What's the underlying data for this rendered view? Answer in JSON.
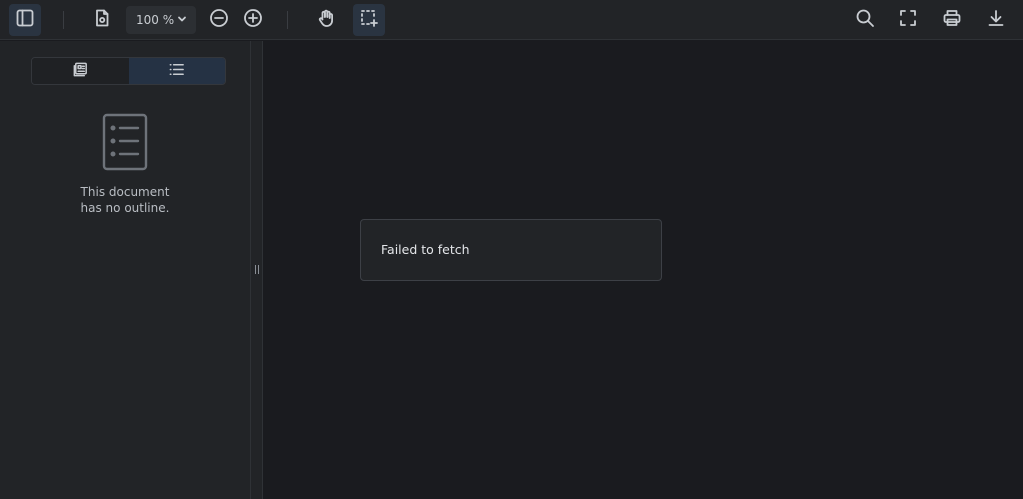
{
  "toolbar": {
    "zoom_value": "100 %",
    "icons": {
      "sidebar_toggle": "sidebar-toggle-icon",
      "document_properties": "document-settings-icon",
      "zoom_dropdown": "chevron-down-icon",
      "zoom_out": "zoom-out-icon",
      "zoom_in": "zoom-in-icon",
      "pan_tool": "hand-icon",
      "selection_tool": "selection-icon",
      "search": "search-icon",
      "fullscreen": "fullscreen-icon",
      "print": "print-icon",
      "download": "download-icon"
    }
  },
  "sidebar": {
    "tabs": [
      {
        "icon": "thumbnails-icon",
        "active": false
      },
      {
        "icon": "outline-list-icon",
        "active": true
      }
    ],
    "empty_icon": "outline-document-icon",
    "empty_line1": "This document",
    "empty_line2": "has no outline."
  },
  "main": {
    "error_message": "Failed to fetch"
  },
  "colors": {
    "background": "#1a1b1f",
    "toolbar": "#222427",
    "active_button": "#2a3441",
    "text": "#c9cdd2"
  }
}
